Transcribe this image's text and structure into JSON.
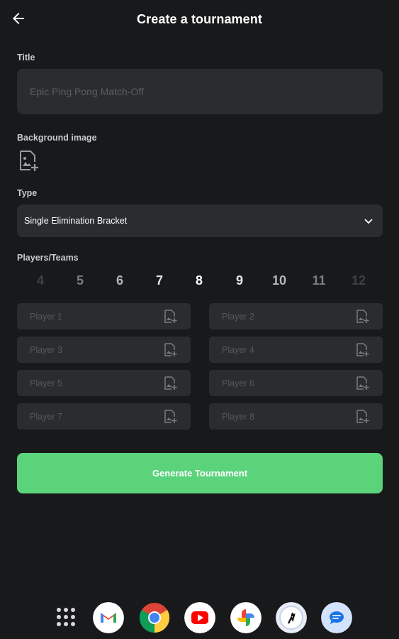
{
  "header": {
    "title": "Create a tournament"
  },
  "form": {
    "title_label": "Title",
    "title_placeholder": "Epic Ping Pong Match-Off",
    "bg_label": "Background image",
    "type_label": "Type",
    "type_value": "Single Elimination Bracket",
    "players_label": "Players/Teams"
  },
  "counts": {
    "options": [
      "4",
      "5",
      "6",
      "7",
      "8",
      "9",
      "10",
      "11",
      "12"
    ],
    "selected": "8"
  },
  "players": [
    {
      "placeholder": "Player 1"
    },
    {
      "placeholder": "Player 2"
    },
    {
      "placeholder": "Player 3"
    },
    {
      "placeholder": "Player 4"
    },
    {
      "placeholder": "Player 5"
    },
    {
      "placeholder": "Player 6"
    },
    {
      "placeholder": "Player 7"
    },
    {
      "placeholder": "Player 8"
    }
  ],
  "actions": {
    "generate_label": "Generate Tournament"
  },
  "dock": {
    "apps": [
      "apps-grid-icon",
      "gmail-icon",
      "chrome-icon",
      "youtube-icon",
      "photos-icon",
      "app-icon",
      "messages-icon"
    ]
  },
  "colors": {
    "accent": "#5bd37b",
    "background": "#18191b",
    "field": "#2a2c2e"
  }
}
